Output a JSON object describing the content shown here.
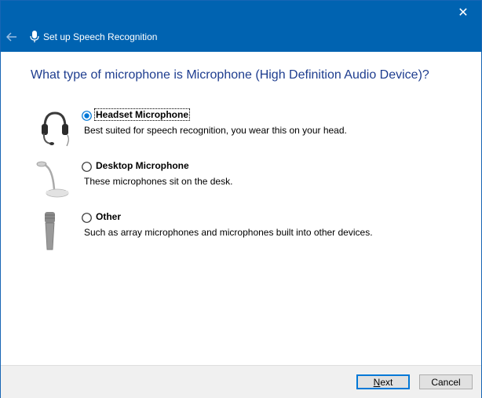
{
  "window": {
    "title": "Set up Speech Recognition",
    "close_glyph": "✕",
    "back_icon": "back-arrow-icon",
    "title_icon": "microphone-icon",
    "accent": "#0063b1"
  },
  "heading": "What type of microphone is Microphone (High Definition Audio Device)?",
  "options": [
    {
      "label": "Headset Microphone",
      "description": "Best suited for speech recognition, you wear this on your head.",
      "selected": true,
      "icon": "headset-icon"
    },
    {
      "label": "Desktop Microphone",
      "description": "These microphones sit on the desk.",
      "selected": false,
      "icon": "desktop-microphone-icon"
    },
    {
      "label": "Other",
      "description": "Such as array microphones and microphones built into other devices.",
      "selected": false,
      "icon": "handheld-microphone-icon"
    }
  ],
  "footer": {
    "next_first": "N",
    "next_rest": "ext",
    "cancel_label": "Cancel"
  }
}
